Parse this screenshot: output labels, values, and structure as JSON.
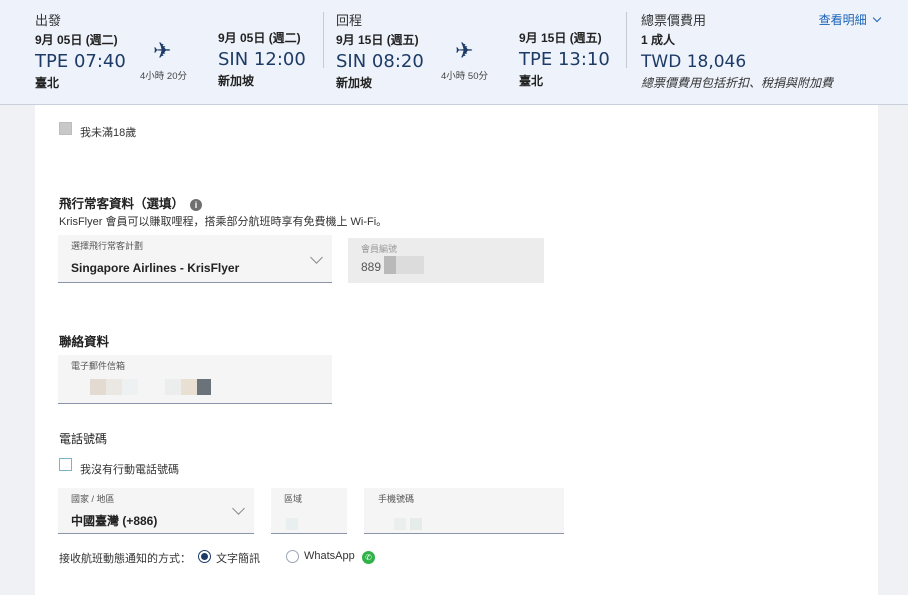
{
  "outbound": {
    "title": "出發",
    "dep_date": "9月 05日 (週二)",
    "dep_time": "TPE 07:40",
    "dep_city": "臺北",
    "duration": "4小時 20分",
    "arr_date": "9月 05日 (週二)",
    "arr_time": "SIN 12:00",
    "arr_city": "新加坡"
  },
  "inbound": {
    "title": "回程",
    "dep_date": "9月 15日 (週五)",
    "dep_time": "SIN 08:20",
    "dep_city": "新加坡",
    "duration": "4小時 50分",
    "arr_date": "9月 15日 (週五)",
    "arr_time": "TPE 13:10",
    "arr_city": "臺北"
  },
  "fare": {
    "title": "總票價費用",
    "passengers": "1 成人",
    "total": "TWD 18,046",
    "note": "總票價費用包括折扣、稅捐與附加費",
    "details_link": "查看明細"
  },
  "form": {
    "under18_label": "我未滿18歲",
    "ff_title": "飛行常客資料（選填）",
    "ff_desc": "KrisFlyer 會員可以賺取哩程，搭乘部分航班時享有免費機上 Wi-Fi。",
    "ff_program_label": "選擇飛行常客計劃",
    "ff_program_value": "Singapore Airlines - KrisFlyer",
    "member_no_label": "會員編號",
    "member_no_value": "889",
    "contact_title": "聯絡資料",
    "email_label": "電子郵件信箱",
    "phone_title": "電話號碼",
    "no_mobile_label": "我沒有行動電話號碼",
    "country_label": "國家 / 地區",
    "country_value": "中國臺灣 (+886)",
    "area_label": "區域",
    "mobile_label": "手機號碼",
    "notify_label": "接收航班動態通知的方式：",
    "notify_sms": "文字簡訊",
    "notify_whatsapp": "WhatsApp"
  }
}
